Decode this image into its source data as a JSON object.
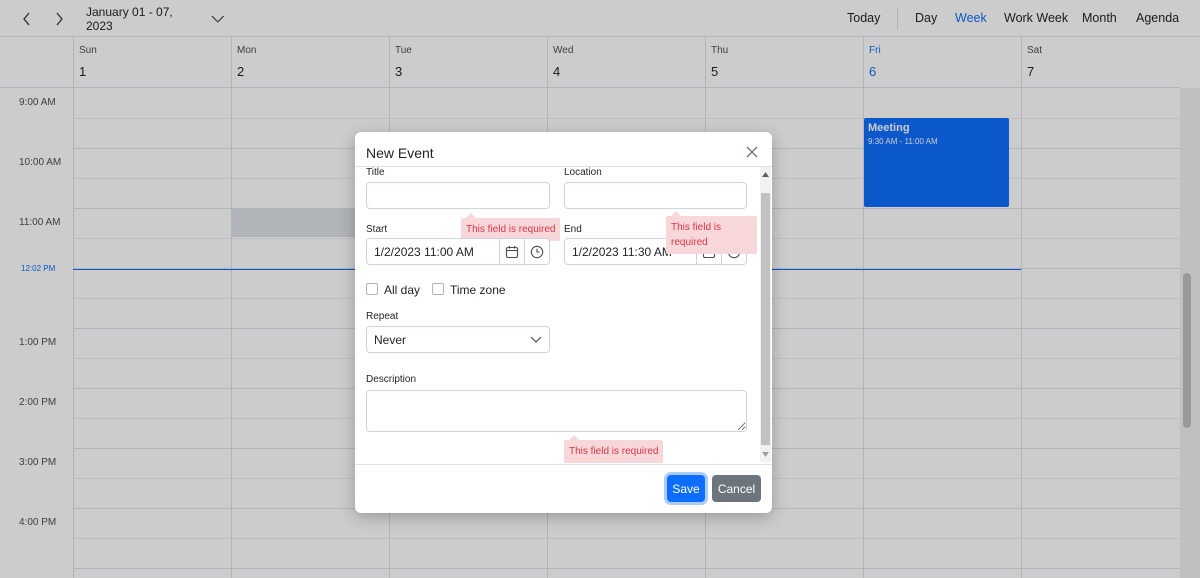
{
  "toolbar": {
    "date_range": "January 01 - 07, 2023",
    "today_label": "Today",
    "views": [
      {
        "label": "Day",
        "active": false
      },
      {
        "label": "Week",
        "active": true
      },
      {
        "label": "Work Week",
        "active": false
      },
      {
        "label": "Month",
        "active": false
      },
      {
        "label": "Agenda",
        "active": false
      }
    ]
  },
  "days": [
    {
      "name": "Sun",
      "num": "1",
      "today": false
    },
    {
      "name": "Mon",
      "num": "2",
      "today": false
    },
    {
      "name": "Tue",
      "num": "3",
      "today": false
    },
    {
      "name": "Wed",
      "num": "4",
      "today": false
    },
    {
      "name": "Thu",
      "num": "5",
      "today": false
    },
    {
      "name": "Fri",
      "num": "6",
      "today": true
    },
    {
      "name": "Sat",
      "num": "7",
      "today": false
    }
  ],
  "time_labels": [
    "9:00 AM",
    "10:00 AM",
    "11:00 AM",
    "1:00 PM",
    "2:00 PM",
    "3:00 PM",
    "4:00 PM"
  ],
  "current_time": "12:02 PM",
  "event": {
    "title": "Meeting",
    "time": "9:30 AM - 11:00 AM"
  },
  "dialog": {
    "title": "New Event",
    "title_label": "Title",
    "title_value": "",
    "location_label": "Location",
    "location_value": "",
    "start_label": "Start",
    "start_value": "1/2/2023 11:00 AM",
    "end_label": "End",
    "end_value": "1/2/2023 11:30 AM",
    "all_day_label": "All day",
    "time_zone_label": "Time zone",
    "repeat_label": "Repeat",
    "repeat_value": "Never",
    "description_label": "Description",
    "description_value": "",
    "errors": {
      "title": "This field is required",
      "location": "This field is required",
      "description": "This field is required"
    },
    "save_label": "Save",
    "cancel_label": "Cancel"
  },
  "colors": {
    "accent": "#0d6efd",
    "event": "#0d6efd",
    "error_bg": "#f8d7da",
    "error_text": "#dc3545",
    "cancel": "#6c757d"
  },
  "icons": [
    "chevron-left-icon",
    "chevron-right-icon",
    "chevron-down-icon",
    "close-icon",
    "calendar-icon",
    "clock-icon"
  ]
}
